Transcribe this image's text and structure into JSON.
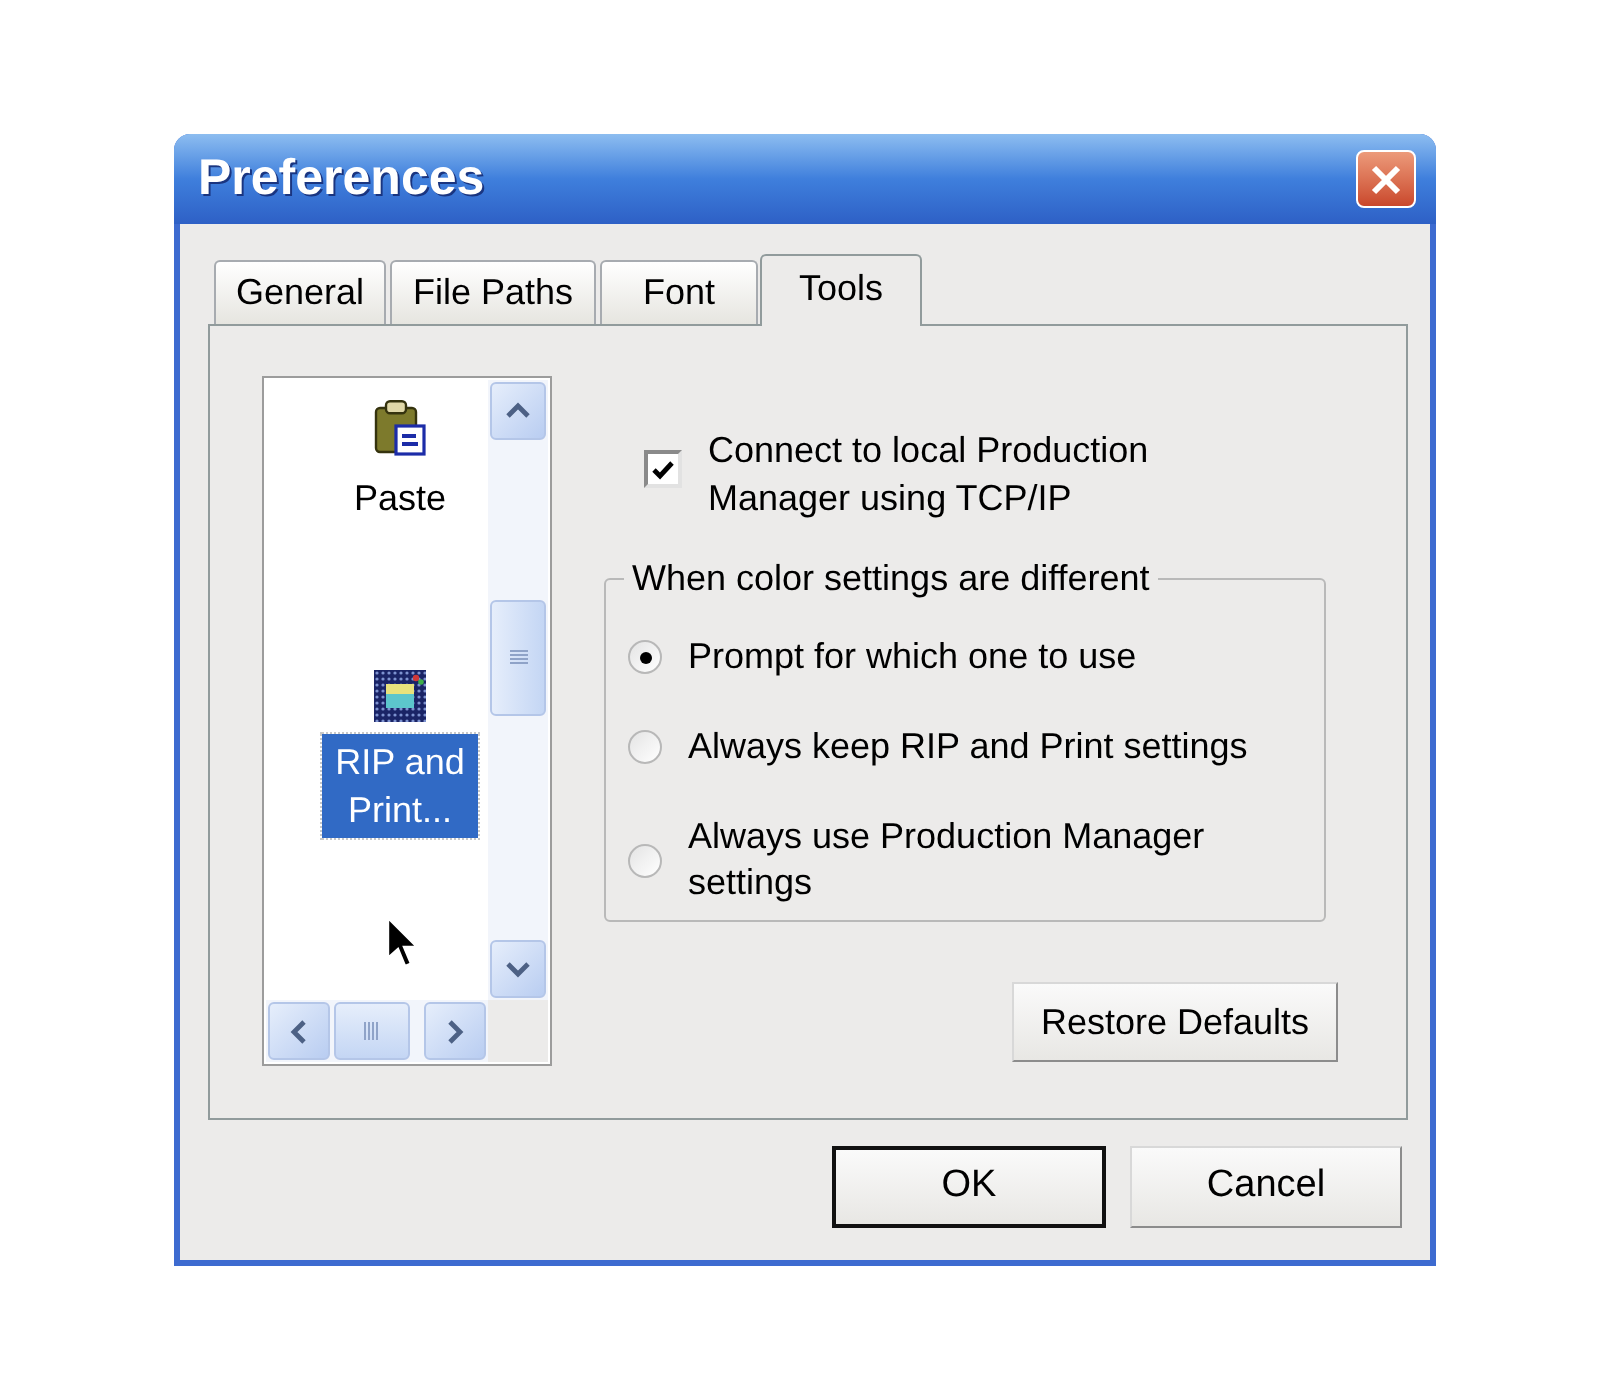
{
  "window": {
    "title": "Preferences"
  },
  "tabs": [
    {
      "label": "General",
      "selected": false
    },
    {
      "label": "File Paths",
      "selected": false
    },
    {
      "label": "Font",
      "selected": false
    },
    {
      "label": "Tools",
      "selected": true
    }
  ],
  "tool_list": {
    "items": [
      {
        "kind": "paste",
        "label": "Paste",
        "selected": false
      },
      {
        "kind": "rip",
        "label": "RIP and Print...",
        "selected": true
      }
    ]
  },
  "connect_option": {
    "label": "Connect to local Production Manager using TCP/IP",
    "checked": true
  },
  "color_group": {
    "title": "When color settings are different",
    "options": [
      {
        "label": "Prompt for which one to use",
        "selected": true
      },
      {
        "label": "Always keep RIP and Print settings",
        "selected": false
      },
      {
        "label": "Always use Production Manager settings",
        "selected": false
      }
    ]
  },
  "restore_button": {
    "label": "Restore Defaults"
  },
  "dialog_buttons": [
    {
      "label": "OK",
      "default": true
    },
    {
      "label": "Cancel",
      "default": false
    }
  ]
}
